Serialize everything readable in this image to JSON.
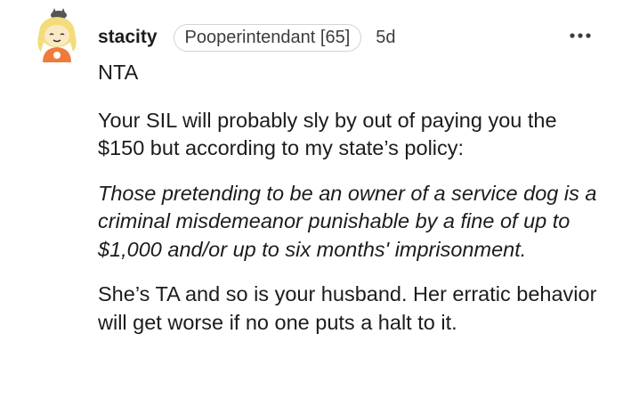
{
  "comment": {
    "username": "stacity",
    "flair": "Pooperintendant [65]",
    "time": "5d",
    "more_icon": "more-dots-icon",
    "avatar_icon": "reddit-avatar-icon",
    "paragraphs": [
      "NTA",
      "Your SIL will probably sly by out of paying you the $150 but according to my state’s policy:",
      "Those pretending to be an owner of a service dog is a criminal misdemeanor punishable by a fine of up to $1,000 and/or up to six months' imprisonment.",
      "She’s TA and so is your husband. Her erratic behavior will get worse if no one puts a halt to it."
    ]
  },
  "colors": {
    "text": "#1c1c1c",
    "secondary": "#3d3d3d",
    "flair_border": "#d4d4d4",
    "avatar_yellow": "#f3dc7a",
    "avatar_orange": "#f07a3c"
  }
}
